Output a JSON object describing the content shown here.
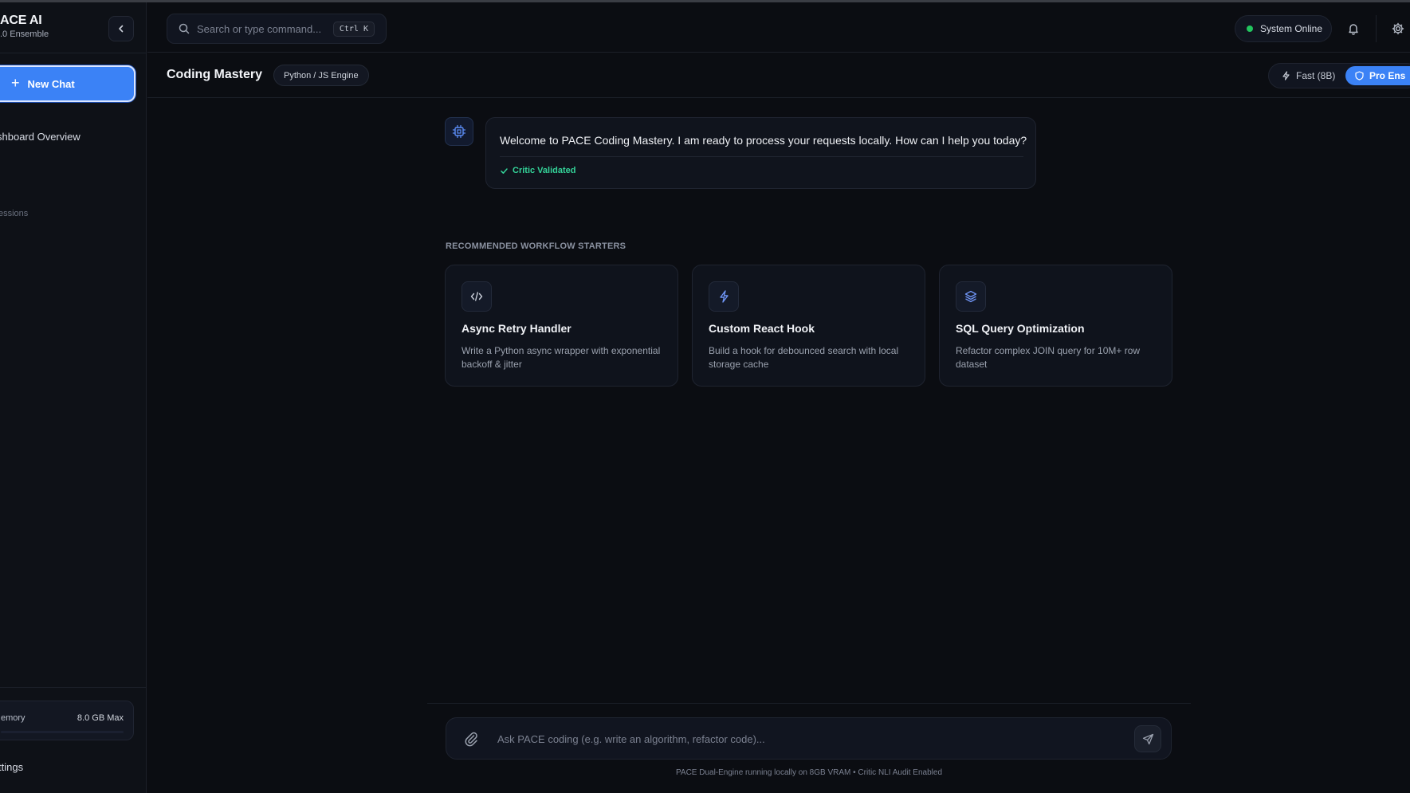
{
  "sidebar": {
    "brand_name": "ACE AI",
    "brand_sub": ".0 Ensemble",
    "new_chat_label": "New Chat",
    "dashboard_label": "shboard Overview",
    "sessions_label": "essions",
    "memory_label": "emory",
    "memory_value": "8.0 GB Max",
    "settings_label": "ttings"
  },
  "header": {
    "search_placeholder": "Search or type command...",
    "shortcut": "Ctrl K",
    "status_label": "System Online"
  },
  "subheader": {
    "title": "Coding Mastery",
    "engine_badge": "Python / JS Engine",
    "mode_fast_label": "Fast (8B)",
    "mode_pro_label": "Pro Ens"
  },
  "chat": {
    "welcome_message": "Welcome to PACE Coding Mastery. I am ready to process your requests locally. How can I help you today?",
    "validated_label": "Critic Validated"
  },
  "starters": {
    "section_label": "RECOMMENDED WORKFLOW STARTERS",
    "cards": [
      {
        "title": "Async Retry Handler",
        "description": "Write a Python async wrapper with exponential backoff & jitter",
        "icon": "code-icon"
      },
      {
        "title": "Custom React Hook",
        "description": "Build a hook for debounced search with local storage cache",
        "icon": "lightning-icon"
      },
      {
        "title": "SQL Query Optimization",
        "description": "Refactor complex JOIN query for 10M+ row dataset",
        "icon": "layers-icon"
      }
    ]
  },
  "composer": {
    "placeholder": "Ask PACE coding (e.g. write an algorithm, refactor code)...",
    "footer_note": "PACE Dual-Engine running locally on 8GB VRAM • Critic NLI Audit Enabled"
  },
  "colors": {
    "accent": "#3b82f6",
    "background": "#0b0d12",
    "success": "#22c55e",
    "validated": "#34d399"
  }
}
